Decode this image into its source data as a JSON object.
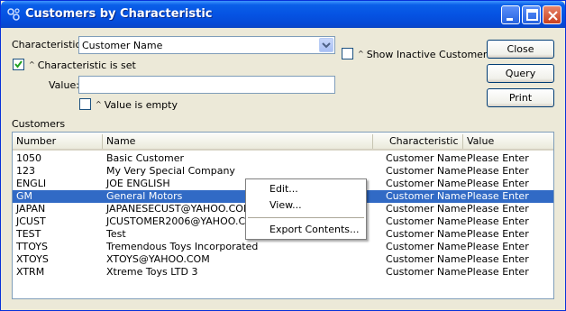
{
  "window": {
    "title": "Customers by Characteristic",
    "icon": "characteristic-app-icon",
    "controls": [
      "minimize-icon",
      "maximize-icon",
      "close-icon"
    ]
  },
  "form": {
    "characteristic_label": "Characteristic:",
    "characteristic_value": "Customer Name",
    "is_set_label": "Characteristic is set",
    "is_set_checked": true,
    "value_label": "Value:",
    "value_text": "",
    "is_empty_label": "Value is empty",
    "is_empty_checked": false,
    "show_inactive_label": "Show Inactive Customers",
    "show_inactive_checked": false
  },
  "buttons": {
    "close": "Close",
    "query": "Query",
    "print": "Print"
  },
  "list": {
    "title": "Customers",
    "columns": [
      "Number",
      "Name",
      "Characteristic",
      "Value"
    ],
    "selected_index": 3,
    "rows": [
      [
        "1050",
        "Basic Customer",
        "Customer Name",
        "Please Enter"
      ],
      [
        "123",
        "My Very Special Company",
        "Customer Name",
        "Please Enter"
      ],
      [
        "ENGLI",
        "JOE ENGLISH",
        "Customer Name",
        "Please Enter"
      ],
      [
        "GM",
        "General Motors",
        "Customer Name",
        "Please Enter"
      ],
      [
        "JAPAN",
        "JAPANESECUST@YAHOO.COM",
        "Customer Name",
        "Please Enter"
      ],
      [
        "JCUST",
        "JCUSTOMER2006@YAHOO.COM",
        "Customer Name",
        "Please Enter"
      ],
      [
        "TEST",
        "Test",
        "Customer Name",
        "Please Enter"
      ],
      [
        "TTOYS",
        "Tremendous Toys Incorporated",
        "Customer Name",
        "Please Enter"
      ],
      [
        "XTOYS",
        "XTOYS@YAHOO.COM",
        "Customer Name",
        "Please Enter"
      ],
      [
        "XTRM",
        "Xtreme Toys LTD 3",
        "Customer Name",
        "Please Enter"
      ]
    ]
  },
  "context_menu": {
    "items": [
      "Edit...",
      "View...",
      "Export Contents..."
    ]
  },
  "colors": {
    "selection": "#316ac5",
    "titlebar": "#0553e3",
    "window_bg": "#ece9d8"
  }
}
